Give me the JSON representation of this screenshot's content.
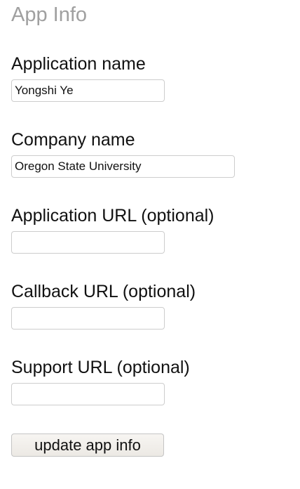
{
  "section": {
    "title": "App Info"
  },
  "fields": {
    "application_name": {
      "label": "Application name",
      "value": "Yongshi Ye",
      "placeholder": ""
    },
    "company_name": {
      "label": "Company name",
      "value": "Oregon State University",
      "placeholder": ""
    },
    "application_url": {
      "label": "Application URL (optional)",
      "value": "",
      "placeholder": ""
    },
    "callback_url": {
      "label": "Callback URL (optional)",
      "value": "",
      "placeholder": ""
    },
    "support_url": {
      "label": "Support URL (optional)",
      "value": "",
      "placeholder": ""
    }
  },
  "actions": {
    "submit_label": "update app info"
  }
}
